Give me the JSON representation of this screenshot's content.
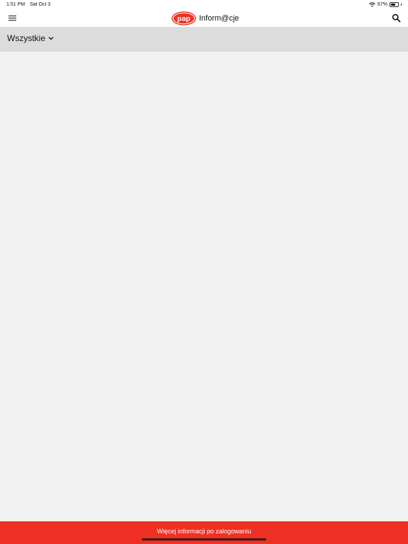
{
  "status_bar": {
    "time": "1:51 PM",
    "date": "Sat Oct 3",
    "battery_percent_label": "67%",
    "battery_level": 0.67
  },
  "nav": {
    "logo_text": "pap",
    "title": "Inform@cje",
    "menu_icon": "hamburger-icon",
    "search_icon": "search-icon"
  },
  "filter": {
    "selected": "Wszystkie",
    "icon": "chevron-down-icon"
  },
  "banner": {
    "text": "Więcej informacji po zalogowaniu"
  },
  "colors": {
    "brand_red": "#ee3124",
    "content_bg": "#f1f1f1",
    "filter_bg": "#dcdcdc"
  }
}
